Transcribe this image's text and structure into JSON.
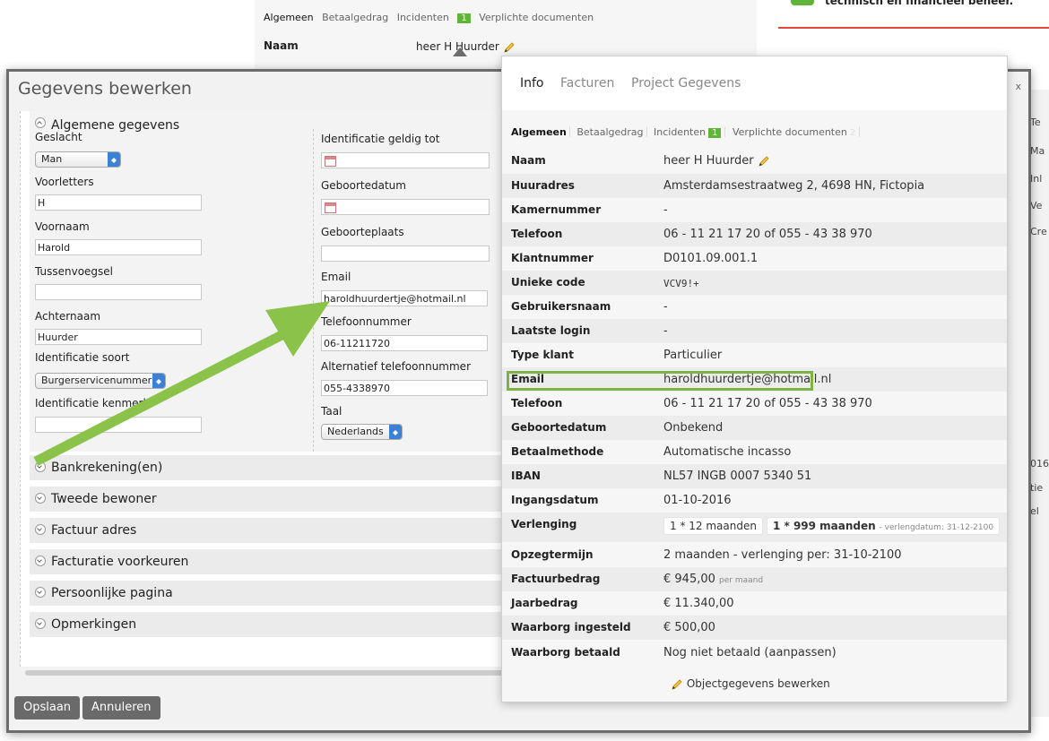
{
  "background": {
    "tabs": [
      {
        "label": "Algemeen"
      },
      {
        "label": "Betaalgedrag"
      },
      {
        "label": "Incidenten",
        "badge": "1"
      },
      {
        "label": "Verplichte documenten"
      }
    ],
    "naam_label": "Naam",
    "naam_value": "heer H Huurder",
    "notice": "technisch en financieel beheer.",
    "side_items": [
      "Te",
      "Ma",
      "Inl",
      "Ve",
      "Cre",
      "016",
      "tie",
      "el"
    ]
  },
  "dialog": {
    "title": "Gegevens bewerken",
    "close": "x",
    "section_general": "Algemene gegevens",
    "left": {
      "geslacht_label": "Geslacht",
      "geslacht_value": "Man",
      "voorletters_label": "Voorletters",
      "voorletters_value": "H",
      "voornaam_label": "Voornaam",
      "voornaam_value": "Harold",
      "tussenvoegsel_label": "Tussenvoegsel",
      "tussenvoegsel_value": "",
      "achternaam_label": "Achternaam",
      "achternaam_value": "Huurder",
      "id_soort_label": "Identificatie soort",
      "id_soort_value": "Burgerservicenummer",
      "id_kenmerk_label": "Identificatie kenmerk",
      "id_kenmerk_value": ""
    },
    "right": {
      "id_geldig_label": "Identificatie geldig tot",
      "geboortedatum_label": "Geboortedatum",
      "geboorteplaats_label": "Geboorteplaats",
      "email_label": "Email",
      "email_value": "haroldhuurdertje@hotmail.nl",
      "telefoon_label": "Telefoonnummer",
      "telefoon_value": "06-11211720",
      "alt_tel_label": "Alternatief telefoonnummer",
      "alt_tel_value": "055-4338970",
      "taal_label": "Taal",
      "taal_value": "Nederlands"
    },
    "sections": [
      "Bankrekening(en)",
      "Tweede bewoner",
      "Factuur adres",
      "Facturatie voorkeuren",
      "Persoonlijke pagina",
      "Opmerkingen"
    ],
    "save": "Opslaan",
    "cancel": "Annuleren"
  },
  "popup": {
    "tabs": [
      "Info",
      "Facturen",
      "Project Gegevens"
    ],
    "subtabs": [
      {
        "label": "Algemeen"
      },
      {
        "label": "Betaalgedrag"
      },
      {
        "label": "Incidenten",
        "badge": "1"
      },
      {
        "label": "Verplichte documenten",
        "badge": "2"
      }
    ],
    "rows": [
      {
        "k": "Naam",
        "v": "heer H Huurder"
      },
      {
        "k": "Huuradres",
        "v": "Amsterdamsestraatweg 2, 4698 HN, Fictopia"
      },
      {
        "k": "Kamernummer",
        "v": "-"
      },
      {
        "k": "Telefoon",
        "v": "06 - 11 21 17 20 of 055 - 43 38 970"
      },
      {
        "k": "Klantnummer",
        "v": "D0101.09.001.1"
      },
      {
        "k": "Unieke code",
        "v": "VCV9!+"
      },
      {
        "k": "Gebruikersnaam",
        "v": "-"
      },
      {
        "k": "Laatste login",
        "v": "-"
      },
      {
        "k": "Type klant",
        "v": "Particulier"
      },
      {
        "k": "Email",
        "v": "haroldhuurdertje@hotmail.nl"
      },
      {
        "k": "Telefoon",
        "v": "06 - 11 21 17 20 of 055 - 43 38 970"
      },
      {
        "k": "Geboortedatum",
        "v": "Onbekend"
      },
      {
        "k": "Betaalmethode",
        "v": "Automatische incasso"
      },
      {
        "k": "IBAN",
        "v": "NL57 INGB 0007 5340 51"
      },
      {
        "k": "Ingangsdatum",
        "v": "01-10-2016"
      }
    ],
    "verlenging": {
      "label": "Verlenging",
      "option1": "1 * 12 maanden",
      "option2": "1 * 999 maanden",
      "note": "- verlengdatum: 31-12-2100"
    },
    "rows2": [
      {
        "k": "Opzegtermijn",
        "v": "2 maanden - verlenging per: 31-10-2100"
      },
      {
        "k": "Factuurbedrag",
        "v": "€ 945,00",
        "small": "per maand"
      },
      {
        "k": "Jaarbedrag",
        "v": "€ 11.340,00"
      },
      {
        "k": "Waarborg ingesteld",
        "v": "€ 500,00"
      },
      {
        "k": "Waarborg betaald",
        "v": "Nog niet betaald (aanpassen)"
      }
    ],
    "edit_link": "Objectgegevens bewerken"
  },
  "colors": {
    "accent_green": "#7cb342",
    "badge_green": "#5fb43a",
    "alert_red": "#e0463a",
    "select_blue": "#3b82d6"
  }
}
